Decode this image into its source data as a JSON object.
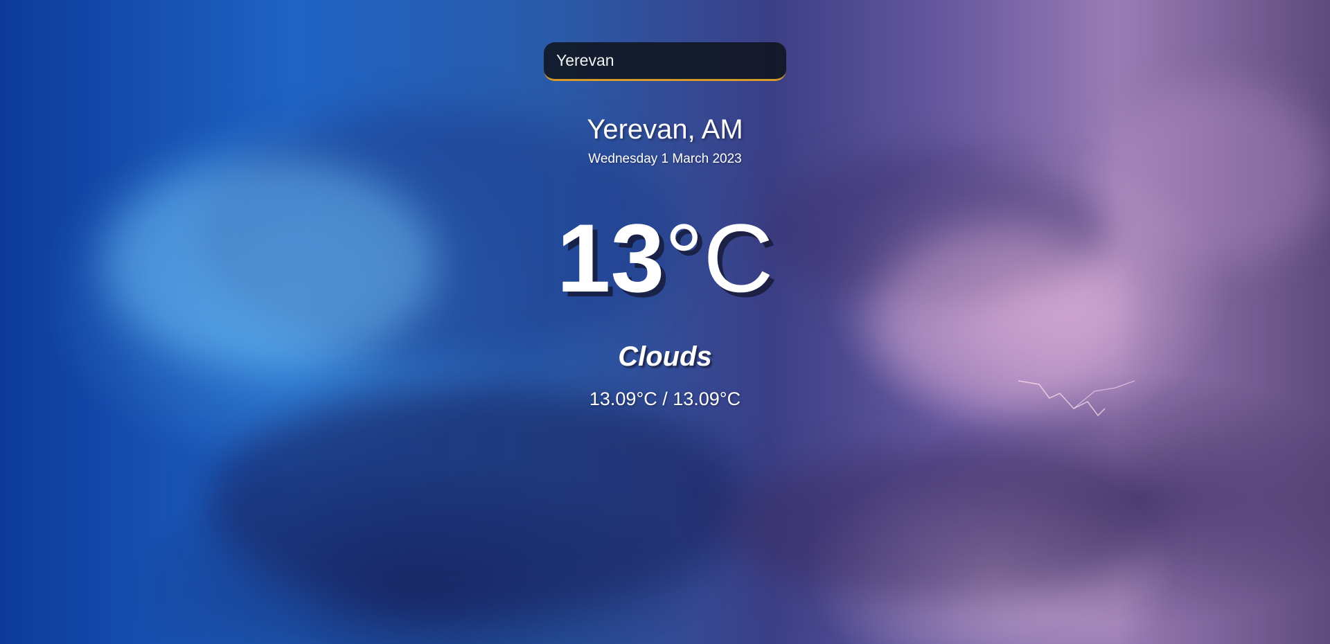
{
  "search": {
    "value": "Yerevan",
    "border_color": "#d69a2a"
  },
  "weather": {
    "location": "Yerevan, AM",
    "date": "Wednesday 1 March 2023",
    "temperature": "13",
    "unit": "°C",
    "condition": "Clouds",
    "min_max": "13.09°C / 13.09°C"
  },
  "background": {
    "theme": "stormy-clouds-with-lightning",
    "colors": [
      "#0d3a9a",
      "#1f63c4",
      "#3b3f86",
      "#9a7cb4"
    ]
  }
}
